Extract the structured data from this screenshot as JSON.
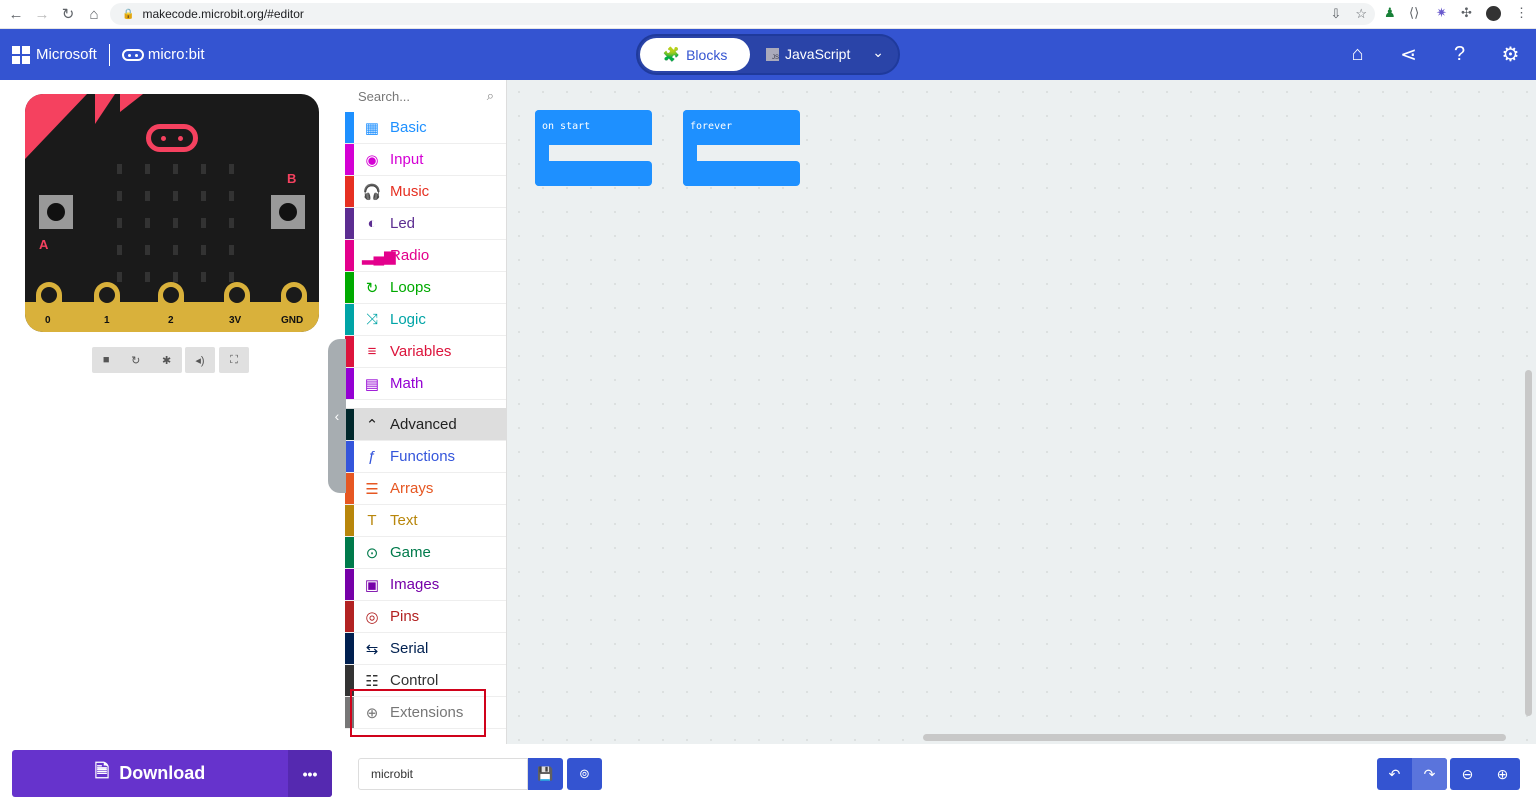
{
  "browser": {
    "url": "makecode.microbit.org/#editor",
    "nav_icons": [
      "back-icon",
      "forward-icon",
      "reload-icon",
      "home-icon"
    ]
  },
  "header": {
    "brand": "Microsoft",
    "product": "micro:bit",
    "editor_toggle": {
      "blocks_label": "Blocks",
      "javascript_label": "JavaScript",
      "active": "Blocks"
    },
    "icons": [
      "home-icon",
      "share-icon",
      "help-icon",
      "settings-icon"
    ]
  },
  "simulator": {
    "pins": [
      "0",
      "1",
      "2",
      "3V",
      "GND"
    ],
    "buttons": [
      "A",
      "B"
    ],
    "controls": [
      "stop-icon",
      "restart-icon",
      "debug-icon",
      "sound-icon",
      "fullscreen-icon"
    ]
  },
  "toolbox": {
    "search_placeholder": "Search...",
    "categories": [
      {
        "label": "Basic",
        "color": "#1e90ff",
        "icon": "▦"
      },
      {
        "label": "Input",
        "color": "#d400d4",
        "icon": "◉"
      },
      {
        "label": "Music",
        "color": "#e63022",
        "icon": "🎧"
      },
      {
        "label": "Led",
        "color": "#5c2d91",
        "icon": "◐"
      },
      {
        "label": "Radio",
        "color": "#e3008c",
        "icon": "▂▄▆"
      },
      {
        "label": "Loops",
        "color": "#00aa00",
        "icon": "↻"
      },
      {
        "label": "Logic",
        "color": "#00a4a6",
        "icon": "⤨"
      },
      {
        "label": "Variables",
        "color": "#dc143c",
        "icon": "≡"
      },
      {
        "label": "Math",
        "color": "#9400d3",
        "icon": "▤"
      }
    ],
    "advanced": {
      "label": "Advanced",
      "color": "#00272b",
      "icon": "⌃"
    },
    "advanced_categories": [
      {
        "label": "Functions",
        "color": "#3455db",
        "icon": "ƒ"
      },
      {
        "label": "Arrays",
        "color": "#e65722",
        "icon": "☰"
      },
      {
        "label": "Text",
        "color": "#b8860b",
        "icon": "T"
      },
      {
        "label": "Game",
        "color": "#007a4b",
        "icon": "⊙"
      },
      {
        "label": "Images",
        "color": "#7600a8",
        "icon": "▣"
      },
      {
        "label": "Pins",
        "color": "#b22222",
        "icon": "◎"
      },
      {
        "label": "Serial",
        "color": "#002050",
        "icon": "⇆"
      },
      {
        "label": "Control",
        "color": "#333333",
        "icon": "☷"
      },
      {
        "label": "Extensions",
        "color": "#777777",
        "icon": "⊕"
      }
    ]
  },
  "workspace": {
    "blocks": [
      {
        "label": "on start"
      },
      {
        "label": "forever"
      }
    ]
  },
  "footer": {
    "download_label": "Download",
    "more_label": "•••",
    "project_name": "microbit",
    "icons": [
      "save-icon",
      "github-icon",
      "undo-icon",
      "redo-icon",
      "zoom-out-icon",
      "zoom-in-icon"
    ]
  }
}
